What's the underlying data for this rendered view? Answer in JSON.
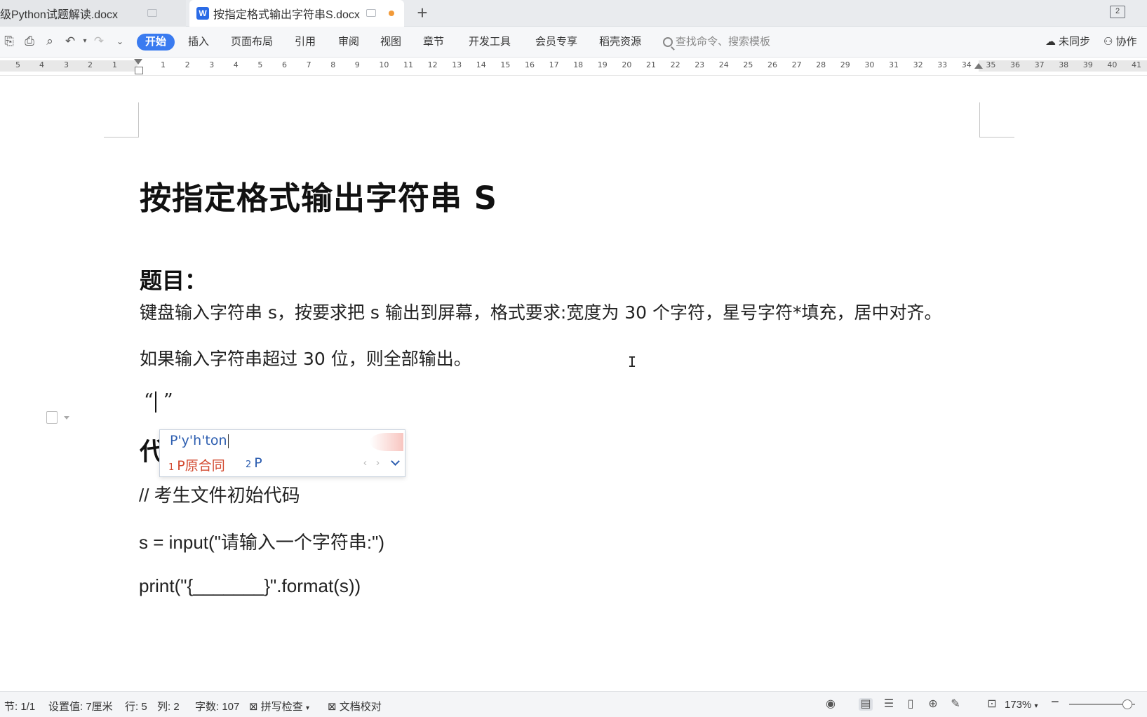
{
  "tabs": {
    "inactive_label": "级Python试题解读.docx",
    "active_label": "按指定格式输出字符串S.docx"
  },
  "window": {
    "badge": "2"
  },
  "ribbon": {
    "menu": [
      "开始",
      "插入",
      "页面布局",
      "引用",
      "审阅",
      "视图",
      "章节",
      "开发工具",
      "会员专享",
      "稻壳资源"
    ],
    "search_placeholder": "查找命令、搜索模板",
    "sync_label": "未同步",
    "collab_label": "协作"
  },
  "ruler": {
    "left_ticks": [
      "5",
      "4",
      "3",
      "2",
      "1"
    ],
    "right_ticks": [
      "1",
      "2",
      "3",
      "4",
      "5",
      "6",
      "7",
      "8",
      "9",
      "10",
      "11",
      "12",
      "13",
      "14",
      "15",
      "16",
      "17",
      "18",
      "19",
      "20",
      "21",
      "22",
      "23",
      "24",
      "25",
      "26",
      "27",
      "28",
      "29",
      "30",
      "31",
      "32",
      "33",
      "34",
      "35",
      "36",
      "37",
      "38",
      "39",
      "40",
      "41"
    ]
  },
  "document": {
    "title": "按指定格式输出字符串 S",
    "heading_question": "题目：",
    "para1": "键盘输入字符串 s，按要求把 s 输出到屏幕，格式要求:宽度为 30 个字符，星号字符*填充，居中对齐。",
    "para2": "如果输入字符串超过 30 位，则全部输出。",
    "quote_open": "“",
    "quote_close": "”",
    "heading_code": "代",
    "code_comment": "//  考生文件初始代码",
    "code_line1": "s = input(\"请输入一个字符串:\")",
    "code_line2": "print(\"{_______}\".format(s))"
  },
  "ime": {
    "composition": "P'y'h'ton",
    "candidate1_num": "1",
    "candidate1": "P原合同",
    "candidate2_num": "2",
    "candidate2": "P"
  },
  "statusbar": {
    "section": "节: 1/1",
    "setting": "设置值: 7厘米",
    "row": "行: 5",
    "col": "列: 2",
    "wordcount": "字数: 107",
    "spellcheck": "拼写检查",
    "proofread": "文档校对",
    "zoom": "173%"
  }
}
